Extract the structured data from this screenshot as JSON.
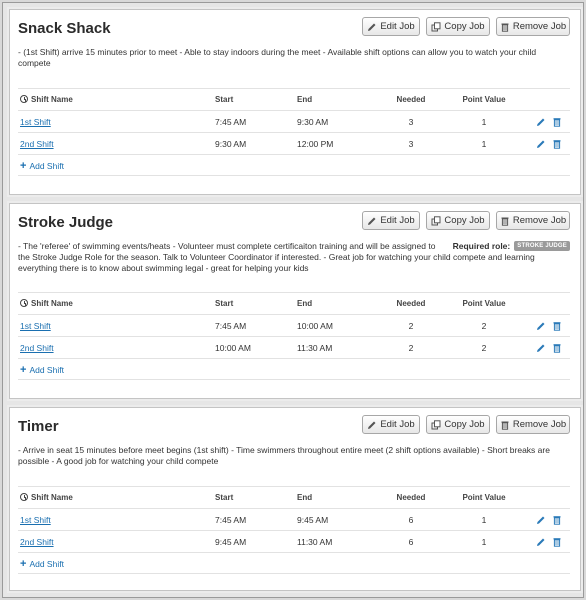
{
  "buttons": {
    "edit": "Edit Job",
    "copy": "Copy Job",
    "remove": "Remove Job"
  },
  "table_headers": {
    "name": "Shift Name",
    "start": "Start",
    "end": "End",
    "needed": "Needed",
    "point": "Point Value"
  },
  "add_shift_label": "Add Shift",
  "jobs": [
    {
      "title": "Snack Shack",
      "description": "- (1st Shift) arrive 15 minutes prior to meet - Able to stay indoors during the meet - Available shift options can allow you to watch your child compete",
      "shifts": [
        {
          "name": "1st Shift",
          "start": "7:45 AM",
          "end": "9:30 AM",
          "needed": "3",
          "point": "1"
        },
        {
          "name": "2nd Shift",
          "start": "9:30 AM",
          "end": "12:00 PM",
          "needed": "3",
          "point": "1"
        }
      ]
    },
    {
      "title": "Stroke Judge",
      "description": "- The 'referee' of swimming events/heats - Volunteer must complete certificaiton training and will be assigned to the Stroke Judge Role for the season. Talk to Volunteer Coordinator if interested. - Great job for watching your child compete and learning everything there is to know about swimming legal - great for helping your kids",
      "required_role_label": "Required role:",
      "required_role": "STROKE JUDGE",
      "shifts": [
        {
          "name": "1st Shift",
          "start": "7:45 AM",
          "end": "10:00 AM",
          "needed": "2",
          "point": "2"
        },
        {
          "name": "2nd Shift",
          "start": "10:00 AM",
          "end": "11:30 AM",
          "needed": "2",
          "point": "2"
        }
      ]
    },
    {
      "title": "Timer",
      "description": "- Arrive in seat 15 minutes before meet begins (1st shift) - Time swimmers throughout entire meet (2 shift options available) - Short breaks are possible - A good job for watching your child compete",
      "shifts": [
        {
          "name": "1st Shift",
          "start": "7:45 AM",
          "end": "9:45 AM",
          "needed": "6",
          "point": "1"
        },
        {
          "name": "2nd Shift",
          "start": "9:45 AM",
          "end": "11:30 AM",
          "needed": "6",
          "point": "1"
        }
      ]
    }
  ]
}
